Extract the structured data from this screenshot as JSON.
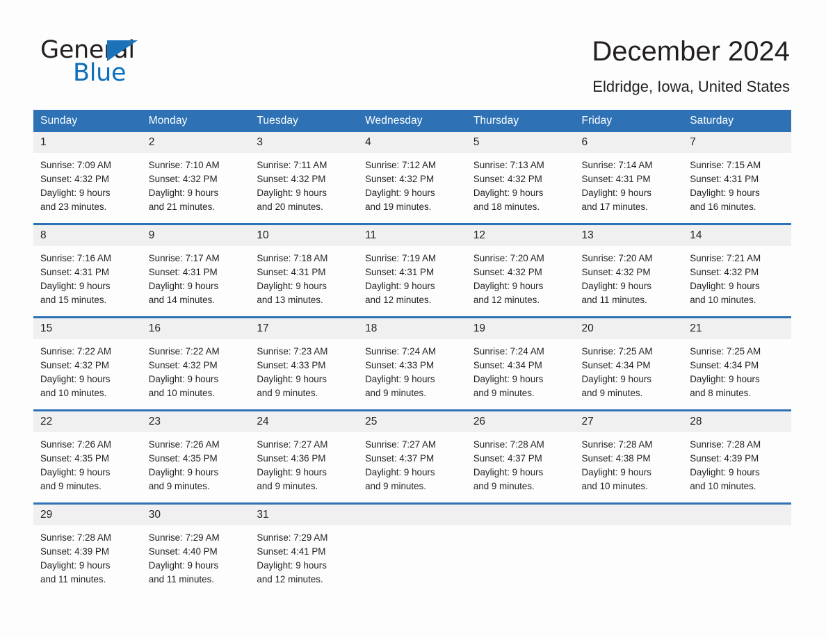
{
  "brand": {
    "name_top": "General",
    "name_bottom": "Blue",
    "triangle_color": "#1c72b8",
    "blue_color": "#0d6fbc"
  },
  "header": {
    "title": "December 2024",
    "subtitle": "Eldridge, Iowa, United States"
  },
  "theme": {
    "header_blue": "#2e72b5",
    "daynum_band": "#f0f0f0",
    "text": "#231f20",
    "page_background": "#fdfdfd"
  },
  "calendar": {
    "weekday_headers": [
      "Sunday",
      "Monday",
      "Tuesday",
      "Wednesday",
      "Thursday",
      "Friday",
      "Saturday"
    ],
    "weeks": [
      [
        {
          "day": "1",
          "sunrise": "Sunrise: 7:09 AM",
          "sunset": "Sunset: 4:32 PM",
          "daylight_line1": "Daylight: 9 hours",
          "daylight_line2": "and 23 minutes."
        },
        {
          "day": "2",
          "sunrise": "Sunrise: 7:10 AM",
          "sunset": "Sunset: 4:32 PM",
          "daylight_line1": "Daylight: 9 hours",
          "daylight_line2": "and 21 minutes."
        },
        {
          "day": "3",
          "sunrise": "Sunrise: 7:11 AM",
          "sunset": "Sunset: 4:32 PM",
          "daylight_line1": "Daylight: 9 hours",
          "daylight_line2": "and 20 minutes."
        },
        {
          "day": "4",
          "sunrise": "Sunrise: 7:12 AM",
          "sunset": "Sunset: 4:32 PM",
          "daylight_line1": "Daylight: 9 hours",
          "daylight_line2": "and 19 minutes."
        },
        {
          "day": "5",
          "sunrise": "Sunrise: 7:13 AM",
          "sunset": "Sunset: 4:32 PM",
          "daylight_line1": "Daylight: 9 hours",
          "daylight_line2": "and 18 minutes."
        },
        {
          "day": "6",
          "sunrise": "Sunrise: 7:14 AM",
          "sunset": "Sunset: 4:31 PM",
          "daylight_line1": "Daylight: 9 hours",
          "daylight_line2": "and 17 minutes."
        },
        {
          "day": "7",
          "sunrise": "Sunrise: 7:15 AM",
          "sunset": "Sunset: 4:31 PM",
          "daylight_line1": "Daylight: 9 hours",
          "daylight_line2": "and 16 minutes."
        }
      ],
      [
        {
          "day": "8",
          "sunrise": "Sunrise: 7:16 AM",
          "sunset": "Sunset: 4:31 PM",
          "daylight_line1": "Daylight: 9 hours",
          "daylight_line2": "and 15 minutes."
        },
        {
          "day": "9",
          "sunrise": "Sunrise: 7:17 AM",
          "sunset": "Sunset: 4:31 PM",
          "daylight_line1": "Daylight: 9 hours",
          "daylight_line2": "and 14 minutes."
        },
        {
          "day": "10",
          "sunrise": "Sunrise: 7:18 AM",
          "sunset": "Sunset: 4:31 PM",
          "daylight_line1": "Daylight: 9 hours",
          "daylight_line2": "and 13 minutes."
        },
        {
          "day": "11",
          "sunrise": "Sunrise: 7:19 AM",
          "sunset": "Sunset: 4:31 PM",
          "daylight_line1": "Daylight: 9 hours",
          "daylight_line2": "and 12 minutes."
        },
        {
          "day": "12",
          "sunrise": "Sunrise: 7:20 AM",
          "sunset": "Sunset: 4:32 PM",
          "daylight_line1": "Daylight: 9 hours",
          "daylight_line2": "and 12 minutes."
        },
        {
          "day": "13",
          "sunrise": "Sunrise: 7:20 AM",
          "sunset": "Sunset: 4:32 PM",
          "daylight_line1": "Daylight: 9 hours",
          "daylight_line2": "and 11 minutes."
        },
        {
          "day": "14",
          "sunrise": "Sunrise: 7:21 AM",
          "sunset": "Sunset: 4:32 PM",
          "daylight_line1": "Daylight: 9 hours",
          "daylight_line2": "and 10 minutes."
        }
      ],
      [
        {
          "day": "15",
          "sunrise": "Sunrise: 7:22 AM",
          "sunset": "Sunset: 4:32 PM",
          "daylight_line1": "Daylight: 9 hours",
          "daylight_line2": "and 10 minutes."
        },
        {
          "day": "16",
          "sunrise": "Sunrise: 7:22 AM",
          "sunset": "Sunset: 4:32 PM",
          "daylight_line1": "Daylight: 9 hours",
          "daylight_line2": "and 10 minutes."
        },
        {
          "day": "17",
          "sunrise": "Sunrise: 7:23 AM",
          "sunset": "Sunset: 4:33 PM",
          "daylight_line1": "Daylight: 9 hours",
          "daylight_line2": "and 9 minutes."
        },
        {
          "day": "18",
          "sunrise": "Sunrise: 7:24 AM",
          "sunset": "Sunset: 4:33 PM",
          "daylight_line1": "Daylight: 9 hours",
          "daylight_line2": "and 9 minutes."
        },
        {
          "day": "19",
          "sunrise": "Sunrise: 7:24 AM",
          "sunset": "Sunset: 4:34 PM",
          "daylight_line1": "Daylight: 9 hours",
          "daylight_line2": "and 9 minutes."
        },
        {
          "day": "20",
          "sunrise": "Sunrise: 7:25 AM",
          "sunset": "Sunset: 4:34 PM",
          "daylight_line1": "Daylight: 9 hours",
          "daylight_line2": "and 9 minutes."
        },
        {
          "day": "21",
          "sunrise": "Sunrise: 7:25 AM",
          "sunset": "Sunset: 4:34 PM",
          "daylight_line1": "Daylight: 9 hours",
          "daylight_line2": "and 8 minutes."
        }
      ],
      [
        {
          "day": "22",
          "sunrise": "Sunrise: 7:26 AM",
          "sunset": "Sunset: 4:35 PM",
          "daylight_line1": "Daylight: 9 hours",
          "daylight_line2": "and 9 minutes."
        },
        {
          "day": "23",
          "sunrise": "Sunrise: 7:26 AM",
          "sunset": "Sunset: 4:35 PM",
          "daylight_line1": "Daylight: 9 hours",
          "daylight_line2": "and 9 minutes."
        },
        {
          "day": "24",
          "sunrise": "Sunrise: 7:27 AM",
          "sunset": "Sunset: 4:36 PM",
          "daylight_line1": "Daylight: 9 hours",
          "daylight_line2": "and 9 minutes."
        },
        {
          "day": "25",
          "sunrise": "Sunrise: 7:27 AM",
          "sunset": "Sunset: 4:37 PM",
          "daylight_line1": "Daylight: 9 hours",
          "daylight_line2": "and 9 minutes."
        },
        {
          "day": "26",
          "sunrise": "Sunrise: 7:28 AM",
          "sunset": "Sunset: 4:37 PM",
          "daylight_line1": "Daylight: 9 hours",
          "daylight_line2": "and 9 minutes."
        },
        {
          "day": "27",
          "sunrise": "Sunrise: 7:28 AM",
          "sunset": "Sunset: 4:38 PM",
          "daylight_line1": "Daylight: 9 hours",
          "daylight_line2": "and 10 minutes."
        },
        {
          "day": "28",
          "sunrise": "Sunrise: 7:28 AM",
          "sunset": "Sunset: 4:39 PM",
          "daylight_line1": "Daylight: 9 hours",
          "daylight_line2": "and 10 minutes."
        }
      ],
      [
        {
          "day": "29",
          "sunrise": "Sunrise: 7:28 AM",
          "sunset": "Sunset: 4:39 PM",
          "daylight_line1": "Daylight: 9 hours",
          "daylight_line2": "and 11 minutes."
        },
        {
          "day": "30",
          "sunrise": "Sunrise: 7:29 AM",
          "sunset": "Sunset: 4:40 PM",
          "daylight_line1": "Daylight: 9 hours",
          "daylight_line2": "and 11 minutes."
        },
        {
          "day": "31",
          "sunrise": "Sunrise: 7:29 AM",
          "sunset": "Sunset: 4:41 PM",
          "daylight_line1": "Daylight: 9 hours",
          "daylight_line2": "and 12 minutes."
        },
        {
          "day": "",
          "sunrise": "",
          "sunset": "",
          "daylight_line1": "",
          "daylight_line2": ""
        },
        {
          "day": "",
          "sunrise": "",
          "sunset": "",
          "daylight_line1": "",
          "daylight_line2": ""
        },
        {
          "day": "",
          "sunrise": "",
          "sunset": "",
          "daylight_line1": "",
          "daylight_line2": ""
        },
        {
          "day": "",
          "sunrise": "",
          "sunset": "",
          "daylight_line1": "",
          "daylight_line2": ""
        }
      ]
    ]
  }
}
